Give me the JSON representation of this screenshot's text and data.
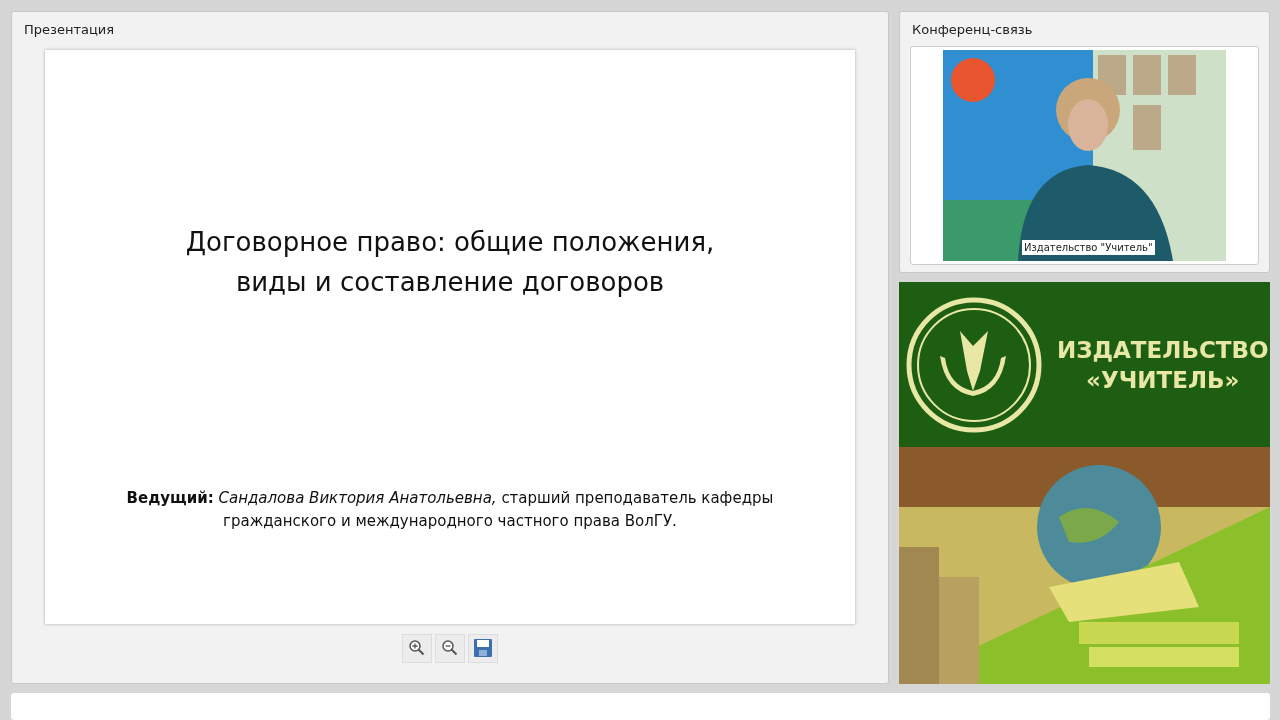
{
  "presentation": {
    "title": "Презентация",
    "slide": {
      "heading": "Договорное право: общие положения,\nвиды и составление договоров",
      "presenter": "**Ведущий:** *Сандалова Виктория Анатольевна,* старший преподаватель кафедры гражданского и международного частного права ВолГУ."
    },
    "toolbar": [
      {
        "kind": "zoom-in"
      },
      {
        "kind": "zoom-out"
      },
      {
        "kind": "save"
      }
    ]
  },
  "conference": {
    "title": "Конференц-связь",
    "video": {
      "caption": "Издательство \"Учитель\""
    }
  },
  "banner": {
    "logo_line_1": "ИЗДАТЕЛЬСТВО",
    "logo_line_2": "«УЧИТЕЛЬ»"
  }
}
